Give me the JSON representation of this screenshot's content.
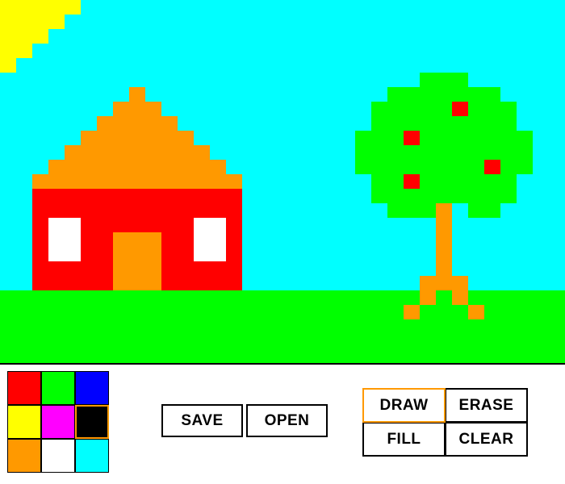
{
  "scene": {
    "sky_color": "#00FFFF",
    "sun_color": "#FFFF00",
    "grass_color": "#00FF00",
    "roof_color": "#FF9900",
    "wall_color": "#FF0000",
    "window_color": "#FFFFFF",
    "door_color": "#FF9900",
    "trunk_color": "#FF9900",
    "leaves_color": "#00FF00",
    "apple_color": "#FF0000"
  },
  "palette": {
    "colors": [
      "#FF0000",
      "#00FF00",
      "#0000FF",
      "#FFFF00",
      "#FF00FF",
      "#000000",
      "#FF9900",
      "#FFFFFF",
      "#00FFFF"
    ],
    "selected_index": 5
  },
  "file_buttons": {
    "save_label": "SAVE",
    "open_label": "OPEN"
  },
  "tools": {
    "draw_label": "DRAW",
    "erase_label": "ERASE",
    "fill_label": "FILL",
    "clear_label": "CLEAR",
    "active_tool": "draw",
    "active_border_color": "#FF9900"
  }
}
